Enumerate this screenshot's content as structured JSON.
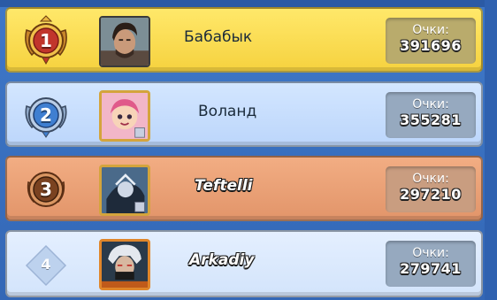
{
  "leaderboard": {
    "score_label": "Очки:",
    "entries": [
      {
        "rank": "1",
        "name": "Бабабык",
        "score": "391696",
        "tier": "gold",
        "avatar": "photo-portrait-avatar"
      },
      {
        "rank": "2",
        "name": "Воланд",
        "score": "355281",
        "tier": "silver",
        "avatar": "pink-girl-brawler-avatar"
      },
      {
        "rank": "3",
        "name": "Teftelli",
        "score": "297210",
        "tier": "bronze",
        "avatar": "dark-warrior-brawler-avatar"
      },
      {
        "rank": "4",
        "name": "Arkadiy",
        "score": "279741",
        "tier": "plain",
        "avatar": "silver-hair-brawler-avatar"
      }
    ]
  },
  "colors": {
    "gold_row": "#f6d23f",
    "silver_row": "#bcd6fb",
    "bronze_row": "#e2956a",
    "plain_row": "#d3e4fb",
    "background": "#3467b6"
  }
}
